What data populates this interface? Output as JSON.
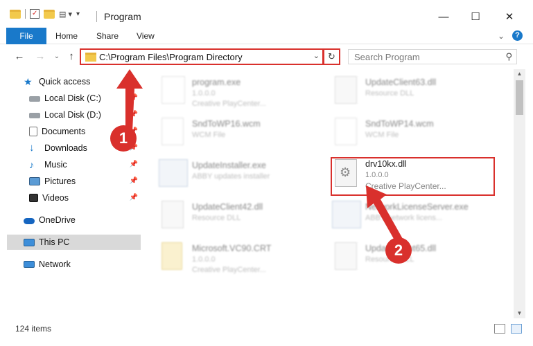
{
  "window": {
    "title": "Program",
    "controls": {
      "minimize": "—",
      "maximize": "☐",
      "close": "✕"
    }
  },
  "ribbon": {
    "tabs": [
      "File",
      "Home",
      "Share",
      "View"
    ],
    "collapse_icon": "⌄",
    "help_icon": "?"
  },
  "navigation": {
    "back": "←",
    "forward": "→",
    "recent": "⌄",
    "up": "↑",
    "address": "C:\\Program Files\\Program Directory",
    "address_dropdown": "⌄",
    "refresh": "↻",
    "search_placeholder": "Search Program",
    "search_icon": "⚲"
  },
  "sidebar": {
    "items": [
      {
        "label": "Quick access",
        "icon": "star-icon",
        "pinned": false
      },
      {
        "label": "Local Disk (C:)",
        "icon": "drive-icon",
        "pinned": true
      },
      {
        "label": "Local Disk (D:)",
        "icon": "drive-icon",
        "pinned": true
      },
      {
        "label": "Documents",
        "icon": "documents-icon",
        "pinned": true
      },
      {
        "label": "Downloads",
        "icon": "downloads-icon",
        "pinned": true
      },
      {
        "label": "Music",
        "icon": "music-icon",
        "pinned": true
      },
      {
        "label": "Pictures",
        "icon": "pictures-icon",
        "pinned": true
      },
      {
        "label": "Videos",
        "icon": "videos-icon",
        "pinned": true
      },
      {
        "label": "OneDrive",
        "icon": "cloud-icon",
        "pinned": false
      },
      {
        "label": "This PC",
        "icon": "computer-icon",
        "pinned": false,
        "selected": true
      },
      {
        "label": "Network",
        "icon": "network-icon",
        "pinned": false
      }
    ],
    "pin_glyph": "📌"
  },
  "files": [
    {
      "name": "program.exe",
      "line1": "1.0.0.0",
      "line2": "Creative PlayCenter...",
      "icon": "exe-icon"
    },
    {
      "name": "UpdateClient63.dll",
      "line1": "Resource DLL",
      "line2": "",
      "icon": "dll-icon"
    },
    {
      "name": "SndToWP16.wcm",
      "line1": "WCM File",
      "line2": "",
      "icon": "file-icon"
    },
    {
      "name": "SndToWP14.wcm",
      "line1": "WCM File",
      "line2": "",
      "icon": "file-icon"
    },
    {
      "name": "UpdateInstaller.exe",
      "line1": "ABBY updates installer",
      "line2": "",
      "icon": "exe-icon"
    },
    {
      "name": "drv10kx.dll",
      "line1": "1.0.0.0",
      "line2": "Creative PlayCenter...",
      "icon": "dll-icon",
      "highlighted": true
    },
    {
      "name": "UpdateClient42.dll",
      "line1": "Resource DLL",
      "line2": "",
      "icon": "dll-icon"
    },
    {
      "name": "NetworkLicenseServer.exe",
      "line1": "ABBY network licens...",
      "line2": "",
      "icon": "exe-icon"
    },
    {
      "name": "Microsoft.VC90.CRT",
      "line1": "1.0.0.0",
      "line2": "Creative PlayCenter...",
      "icon": "folder-doc-icon"
    },
    {
      "name": "UpdateClient65.dll",
      "line1": "Resource DLL",
      "line2": "",
      "icon": "dll-icon"
    }
  ],
  "status": {
    "count": "124 items"
  },
  "annotations": {
    "step1": "1",
    "step2": "2",
    "color": "#d9302c"
  }
}
